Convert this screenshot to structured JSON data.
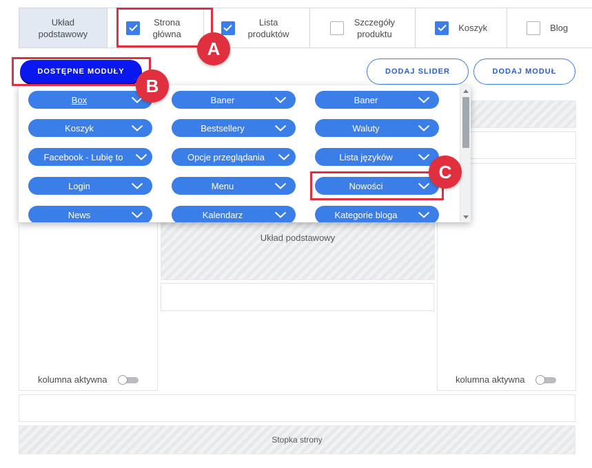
{
  "tabs": {
    "base_label": "Układ podstawowy",
    "items": [
      {
        "label": "Strona główna",
        "checked": true
      },
      {
        "label": "Lista produktów",
        "checked": true
      },
      {
        "label": "Szczegóły produktu",
        "checked": false
      },
      {
        "label": "Koszyk",
        "checked": true
      },
      {
        "label": "Blog",
        "checked": false
      }
    ]
  },
  "toolbar": {
    "modules_button": "DOSTĘPNE MODUŁY",
    "add_slider_button": "DODAJ SLIDER",
    "add_module_button": "DODAJ MODUŁ"
  },
  "modules": {
    "col1": [
      "Box",
      "Koszyk",
      "Facebook - Lubię to",
      "Login",
      "News"
    ],
    "col2": [
      "Baner",
      "Bestsellery",
      "Opcje przeglądania",
      "Menu",
      "Kalendarz"
    ],
    "col3": [
      "Baner",
      "Waluty",
      "Lista języków",
      "Nowości",
      "Kategorie bloga"
    ]
  },
  "layout": {
    "center_label": "Układ podstawowy",
    "left_column_toggle": "kolumna aktywna",
    "right_column_toggle": "kolumna aktywna",
    "footer_label": "Stopka strony"
  },
  "annotations": {
    "a": "A",
    "b": "B",
    "c": "C",
    "color": "#e03040"
  },
  "colors": {
    "accent": "#3b7ee8",
    "primary_button": "#0a18f0"
  }
}
